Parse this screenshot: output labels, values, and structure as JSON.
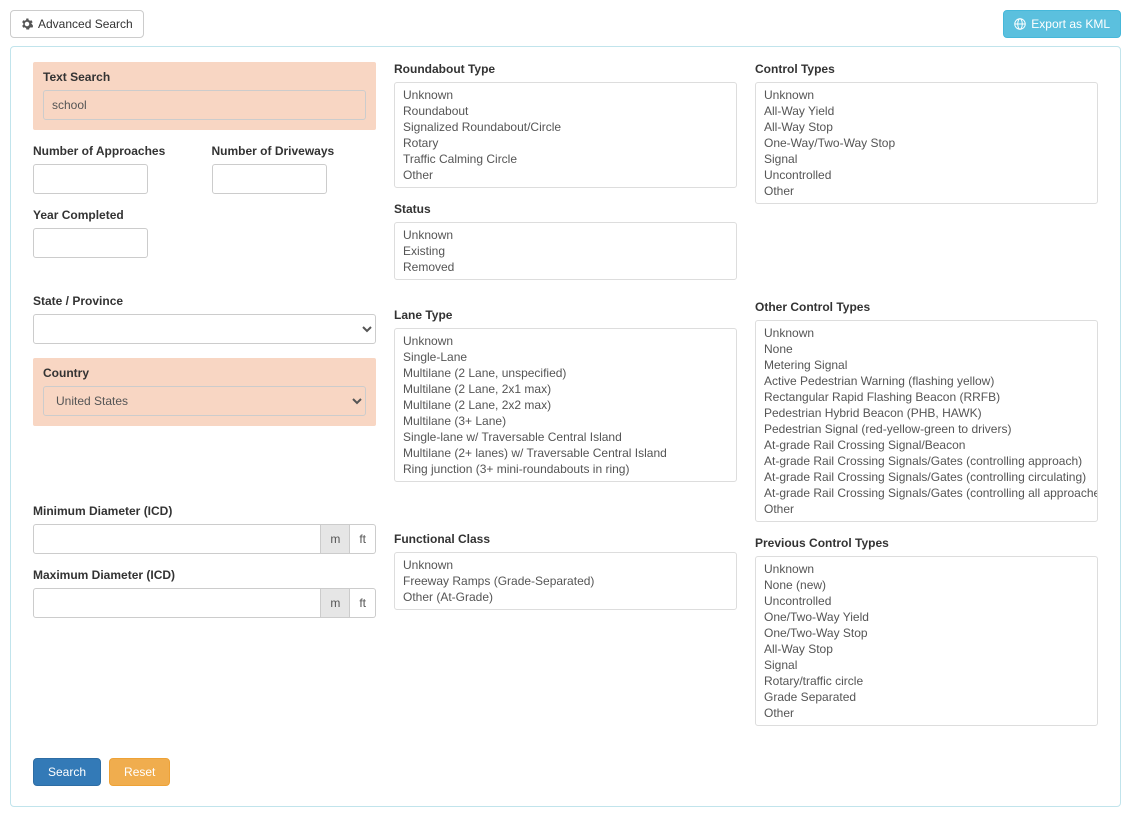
{
  "top": {
    "advanced_search": "Advanced Search",
    "export_kml": "Export as KML"
  },
  "col1": {
    "text_search_label": "Text Search",
    "text_search_value": "school",
    "num_approaches_label": "Number of Approaches",
    "num_driveways_label": "Number of Driveways",
    "year_completed_label": "Year Completed",
    "state_label": "State / Province",
    "country_label": "Country",
    "country_value": "United States",
    "min_diam_label": "Minimum Diameter (ICD)",
    "max_diam_label": "Maximum Diameter (ICD)",
    "unit_m": "m",
    "unit_ft": "ft"
  },
  "col2": {
    "roundabout_type_label": "Roundabout Type",
    "roundabout_type_options": [
      "Unknown",
      "Roundabout",
      "Signalized Roundabout/Circle",
      "Rotary",
      "Traffic Calming Circle",
      "Other"
    ],
    "status_label": "Status",
    "status_options": [
      "Unknown",
      "Existing",
      "Removed"
    ],
    "lane_type_label": "Lane Type",
    "lane_type_options": [
      "Unknown",
      "Single-Lane",
      "Multilane (2 Lane, unspecified)",
      "Multilane (2 Lane, 2x1 max)",
      "Multilane (2 Lane, 2x2 max)",
      "Multilane (3+ Lane)",
      "Single-lane w/ Traversable Central Island",
      "Multilane (2+ lanes) w/ Traversable Central Island",
      "Ring junction (3+ mini-roundabouts in ring)"
    ],
    "functional_class_label": "Functional Class",
    "functional_class_options": [
      "Unknown",
      "Freeway Ramps (Grade-Separated)",
      "Other (At-Grade)"
    ]
  },
  "col3": {
    "control_types_label": "Control Types",
    "control_types_options": [
      "Unknown",
      "All-Way Yield",
      "All-Way Stop",
      "One-Way/Two-Way Stop",
      "Signal",
      "Uncontrolled",
      "Other"
    ],
    "other_control_label": "Other Control Types",
    "other_control_options": [
      "Unknown",
      "None",
      "Metering Signal",
      "Active Pedestrian Warning (flashing yellow)",
      "Rectangular Rapid Flashing Beacon (RRFB)",
      "Pedestrian Hybrid Beacon (PHB, HAWK)",
      "Pedestrian Signal (red-yellow-green to drivers)",
      "At-grade Rail Crossing Signal/Beacon",
      "At-grade Rail Crossing Signals/Gates (controlling approach)",
      "At-grade Rail Crossing Signals/Gates (controlling circulating)",
      "At-grade Rail Crossing Signals/Gates (controlling all approaches)",
      "Other"
    ],
    "prev_control_label": "Previous Control Types",
    "prev_control_options": [
      "Unknown",
      "None (new)",
      "Uncontrolled",
      "One/Two-Way Yield",
      "One/Two-Way Stop",
      "All-Way Stop",
      "Signal",
      "Rotary/traffic circle",
      "Grade Separated",
      "Other"
    ]
  },
  "footer": {
    "search": "Search",
    "reset": "Reset"
  }
}
